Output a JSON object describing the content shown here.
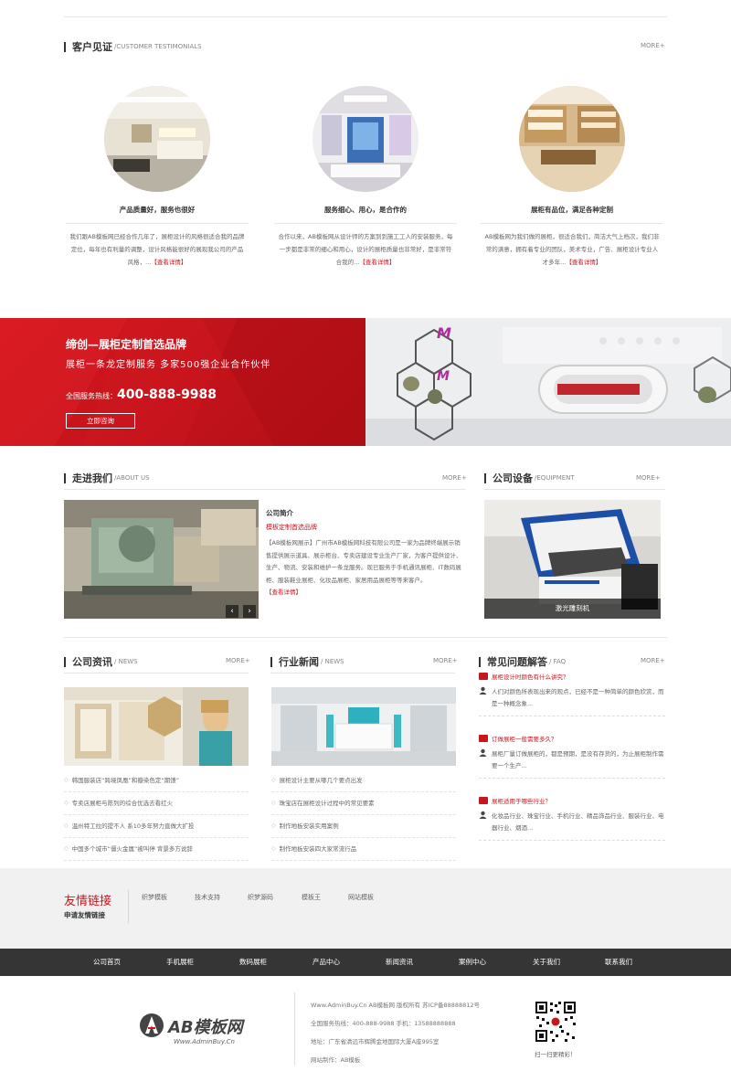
{
  "testimonials": {
    "title_cn": "客户见证",
    "title_en": "/CUSTOMER TESTIMONIALS",
    "more": "MORE+",
    "items": [
      {
        "title": "产品质量好，服务也很好",
        "desc": "我们跟AB模板网已经合作几年了，展柜设计的风格很适合我的品牌定位，每年也有利量的调整，设计风格能很好的展现我公司的产品风格，...",
        "link": "【查看详情】"
      },
      {
        "title": "服务细心、用心，是合作的",
        "desc": "合作以来，AB模板网从设计师的方案到到施工工人的安装服务，每一步都是非常的细心和用心，设计的展柜质量也非常好，是非常符合我的...",
        "link": "【查看详情】"
      },
      {
        "title": "展柜有品位，满足各种定制",
        "desc": "AB模板网为我们做的展柜，很适合我们，简洁大气上档次，我们非常的满意，拥有着专业的团队，美术专业，广告、展柜设计专业人才多年...",
        "link": "【查看详情】"
      }
    ]
  },
  "banner": {
    "title": "缔创—展柜定制首选品牌",
    "subtitle": "展柜一条龙定制服务  多家500强企业合作伙伴",
    "hotline_label": "全国服务热线：",
    "hotline": "400-888-9988",
    "button": "立即咨询"
  },
  "about": {
    "title_cn": "走进我们",
    "title_en": "/ABOUT US",
    "more": "MORE+",
    "heading": "公司简介",
    "subheading": "模板定制首选品牌",
    "text": "【AB模板网展示】广州市AB模板网科技有限公司是一家为品牌终端展示销售提供展示道具、展示柜台、专卖店建设专业生产厂家，为客户提供设计、生产、物流、安装和维护一条龙服务。现已服务于手机通讯展柜、IT数码展柜、服装鞋业展柜、化妆品展柜、家居用品展柜等等来客户。",
    "link": "【查看详情】",
    "prev": "‹",
    "next": "›"
  },
  "equipment": {
    "title_cn": "公司设备",
    "title_en": "/EQUIPMENT",
    "more": "MORE+",
    "caption": "激光雕刻机"
  },
  "company_news": {
    "title_cn": "公司资讯",
    "title_en": "/ NEWS",
    "more": "MORE+",
    "items": [
      "韩国服装店“跨境凤凰”和瓣染色定“期馈”",
      "专卖店展柜与陈列的综合优选去看红火",
      "温州特工拉的提不人 系10多年努力直做大扩投",
      "中国多个城市“僵火金属”被叫停 背景多方说辞"
    ]
  },
  "industry_news": {
    "title_cn": "行业新闻",
    "title_en": "/ NEWS",
    "more": "MORE+",
    "items": [
      "展柜设计主要从哪几个要点出发",
      "珠宝店在展柜设计过程中的常见要素",
      "制作地板安装实用案例",
      "制作地板安装四大家常流行品"
    ]
  },
  "faq": {
    "title_cn": "常见问题解答",
    "title_en": "/ FAQ",
    "more": "MORE+",
    "items": [
      {
        "q": "展柜设计时颜色有什么讲究？",
        "a": "人们对颜色所表现出来的观点，已经不是一种简单的颜色欣赏，而是一种概念象..."
      },
      {
        "q": "订做展柜一般需要多久？",
        "a": "展柜厂量订做展柜的，都是预期，是没有存货的，为止展柜制作需要一个生产..."
      },
      {
        "q": "展柜适用于哪些行业？",
        "a": "化妆品行业、珠宝行业、手机行业、精品饰品行业、服装行业、电器行业、烟酒..."
      }
    ]
  },
  "links": {
    "title": "友情链接",
    "subtitle": "申请友情链接",
    "items": [
      "织梦模板",
      "技术支持",
      "织梦源码",
      "模板王",
      "网站模板"
    ]
  },
  "nav": {
    "items": [
      "公司首页",
      "手机展柜",
      "数码展柜",
      "产品中心",
      "新闻资讯",
      "案例中心",
      "关于我们",
      "联系我们"
    ]
  },
  "footer": {
    "logo_text": "AB模板网",
    "logo_url": "Www.AdminBuy.Cn",
    "lines": [
      "Www.AdminBuy.Cn AB模板网 版权所有 苏ICP备88888812号",
      "全国服务热线：400-888-9988   手机：13588888888",
      "地址：广东省清远市辉腾金地国际大厦A座995室",
      "网站制作：AB模板"
    ],
    "qr_caption": "扫一扫更精彩！"
  },
  "colors": {
    "accent": "#c8161e",
    "nav_bg": "#353535",
    "links_bg": "#f1f1f1"
  }
}
